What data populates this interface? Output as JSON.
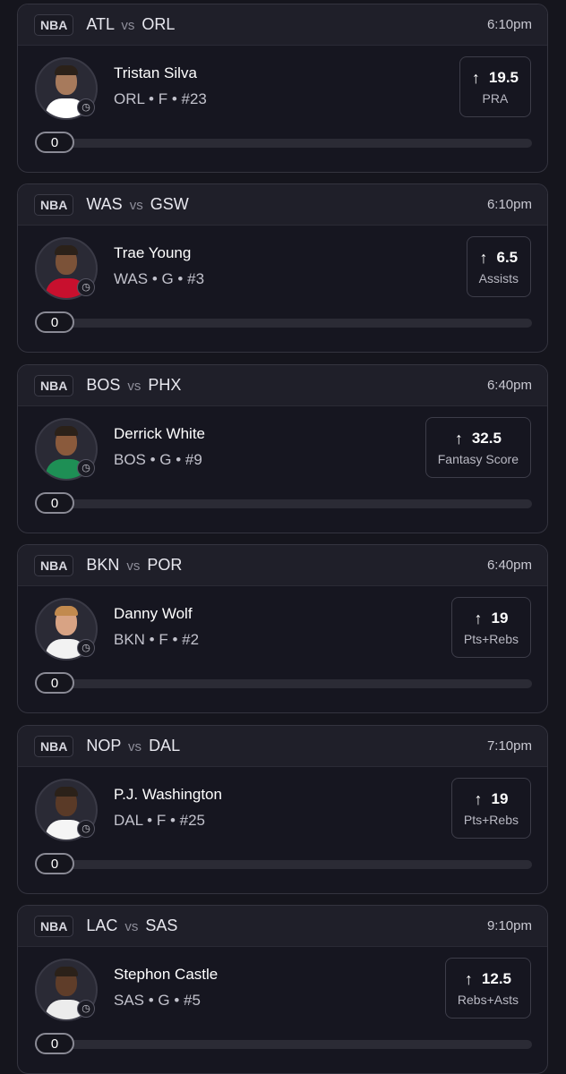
{
  "cards": [
    {
      "league": "NBA",
      "team1": "ATL",
      "vs": "vs",
      "team2": "ORL",
      "time": "6:10pm",
      "player": "Tristan Silva",
      "meta": "ORL • F • #23",
      "line": "19.5",
      "stat": "PRA",
      "progress_value": "0",
      "progress_fraction": 0
    },
    {
      "league": "NBA",
      "team1": "WAS",
      "vs": "vs",
      "team2": "GSW",
      "time": "6:10pm",
      "player": "Trae Young",
      "meta": "WAS • G • #3",
      "line": "6.5",
      "stat": "Assists",
      "progress_value": "0",
      "progress_fraction": 0
    },
    {
      "league": "NBA",
      "team1": "BOS",
      "vs": "vs",
      "team2": "PHX",
      "time": "6:40pm",
      "player": "Derrick White",
      "meta": "BOS • G • #9",
      "line": "32.5",
      "stat": "Fantasy Score",
      "progress_value": "0",
      "progress_fraction": 0
    },
    {
      "league": "NBA",
      "team1": "BKN",
      "vs": "vs",
      "team2": "POR",
      "time": "6:40pm",
      "player": "Danny Wolf",
      "meta": "BKN • F • #2",
      "line": "19",
      "stat": "Pts+Rebs",
      "progress_value": "0",
      "progress_fraction": 0
    },
    {
      "league": "NBA",
      "team1": "NOP",
      "vs": "vs",
      "team2": "DAL",
      "time": "7:10pm",
      "player": "P.J. Washington",
      "meta": "DAL • F • #25",
      "line": "19",
      "stat": "Pts+Rebs",
      "progress_value": "0",
      "progress_fraction": 0
    },
    {
      "league": "NBA",
      "team1": "LAC",
      "vs": "vs",
      "team2": "SAS",
      "time": "9:10pm",
      "player": "Stephon Castle",
      "meta": "SAS • G • #5",
      "line": "12.5",
      "stat": "Rebs+Asts",
      "progress_value": "0",
      "progress_fraction": 0
    }
  ],
  "icons": {
    "direction": "arrow-up-icon",
    "status": "clock-icon"
  },
  "colors": {
    "background": "#15151d",
    "card": "#161620",
    "header": "#1f1f29",
    "track": "#2b2b35"
  }
}
